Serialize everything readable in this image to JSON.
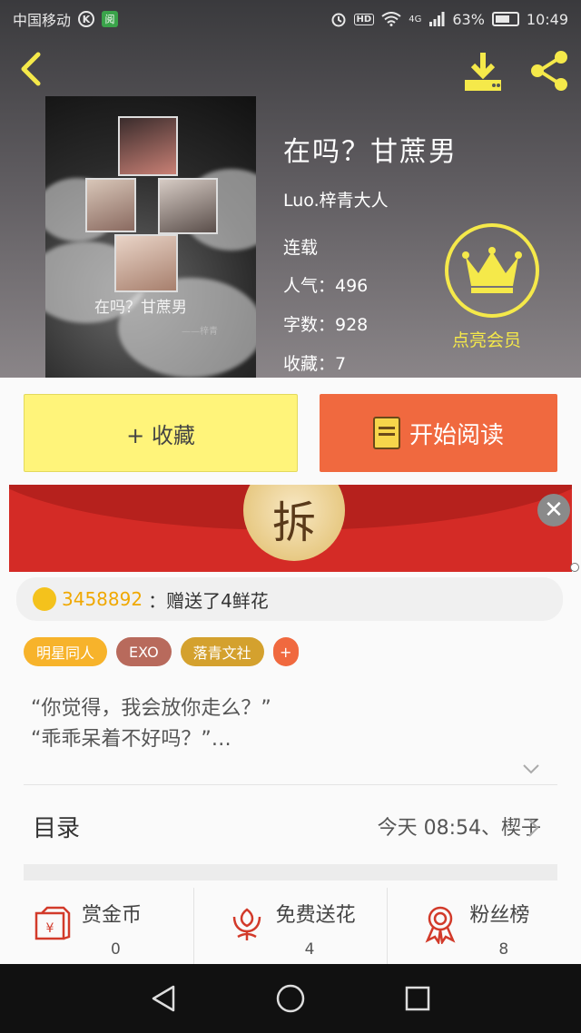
{
  "status_bar": {
    "carrier": "中国移动",
    "network": "4G",
    "battery": "63%",
    "time": "10:49",
    "hd": "HD"
  },
  "book": {
    "title": "在吗？甘蔗男",
    "author": "Luo.梓青大人",
    "status": "连载",
    "popularity": "人气：496",
    "word_count": "字数：928",
    "favorites": "收藏：7",
    "cover_caption": "在吗？甘蔗男",
    "cover_signature": "——梓青"
  },
  "vip": {
    "label": "点亮会员"
  },
  "buttons": {
    "favorite": "+ 收藏",
    "read": "开始阅读"
  },
  "ad": {
    "coin_text": "拆",
    "close": "✕"
  },
  "gift": {
    "user": "3458892",
    "text": "：赠送了4鲜花"
  },
  "tags": [
    "明星同人",
    "EXO",
    "落青文社",
    "+"
  ],
  "synopsis": "“你觉得，我会放你走么？”\n“乖乖呆着不好吗？”…",
  "toc": {
    "label": "目录",
    "latest": "今天 08:54、楔子"
  },
  "actions": [
    {
      "label": "赏金币",
      "count": "0",
      "icon": "coin-envelope-icon"
    },
    {
      "label": "免费送花",
      "count": "4",
      "icon": "flower-icon"
    },
    {
      "label": "粉丝榜",
      "count": "8",
      "icon": "medal-icon"
    }
  ],
  "colors": {
    "accent_yellow": "#fff47a",
    "accent_orange": "#f0693f",
    "vip_gold": "#f5e94a",
    "ad_red": "#d42b26"
  }
}
